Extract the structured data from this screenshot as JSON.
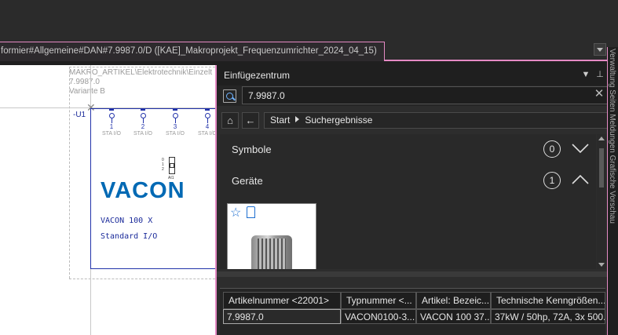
{
  "document_tab": {
    "title": "formier#Allgemeine#DAN#7.9987.0/D ([KAE]_Makroprojekt_Frequenzumrichter_2024_04_15)"
  },
  "canvas": {
    "macro_path": "MAKRO_ARTIKEL\\Elektrotechnik\\Einzelt",
    "macro_number": "7.9987.0",
    "variant": "Variante B",
    "device_tag": "-U1",
    "terminals": [
      {
        "num": "1",
        "label": "STA I/O"
      },
      {
        "num": "2",
        "label": "STA I/O"
      },
      {
        "num": "3",
        "label": "STA I/O"
      },
      {
        "num": "4",
        "label": "STA I/O"
      }
    ],
    "ai_label": "AI1",
    "brand": "VACON",
    "model_line1": "VACON 100 X",
    "model_line2": "Standard I/O"
  },
  "panel": {
    "title": "Einfügezentrum",
    "search_value": "7.9987.0",
    "breadcrumb": [
      "Start",
      "Suchergebnisse"
    ],
    "categories": [
      {
        "label": "Symbole",
        "count": "0",
        "expanded": false
      },
      {
        "label": "Geräte",
        "count": "1",
        "expanded": true
      }
    ]
  },
  "table": {
    "columns": [
      "Artikelnummer <22001>",
      "Typnummer <...",
      "Artikel: Bezeic...",
      "Technische Kenngrößen..."
    ],
    "rows": [
      [
        "7.9987.0",
        "VACON0100-3...",
        "VACON 100 37...",
        "37kW / 50hp, 72A, 3x 500..."
      ]
    ]
  },
  "side_strip": {
    "text": "Verwaltung  Seiten  Meldungen  Grafische Vorschau"
  },
  "colors": {
    "accent_pink": "#e58ac4",
    "vacon_blue": "#0069b4",
    "schematic_blue": "#2233aa"
  }
}
